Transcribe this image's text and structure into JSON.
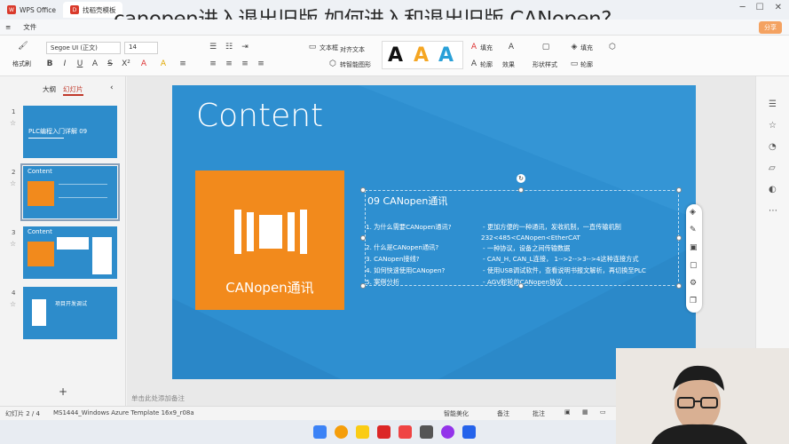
{
  "titlebar": {
    "tabs": [
      {
        "label": "WPS Office",
        "active": false
      },
      {
        "label": "找稻壳模板",
        "active": true
      }
    ],
    "overlay_title": "canopen进入退出旧版,如何进入和退出旧版 CANopen?"
  },
  "menubar": {
    "file": "文件",
    "share": "分享"
  },
  "ribbon": {
    "paste_label": "格式刷",
    "font_name": "Segoe UI (正文)",
    "font_size": "14",
    "text_box": "文本框",
    "convert_smartart": "转智能图形",
    "text_direction": "对齐文本",
    "fill": "填充",
    "outline": "轮廓",
    "effect": "效果",
    "shape_format": "形状样式",
    "fill2": "填充",
    "outline2": "轮廓"
  },
  "left_panel": {
    "tabs": [
      "大纲",
      "幻灯片"
    ],
    "active_tab": "幻灯片",
    "slides": [
      {
        "num": "1",
        "title": "PLC编程入门详解 09"
      },
      {
        "num": "2",
        "title": "Content"
      },
      {
        "num": "3",
        "title": "Content"
      },
      {
        "num": "4",
        "title": "项目开发调试"
      }
    ],
    "add": "+"
  },
  "slide": {
    "title": "Content",
    "box_text": "CANopen通讯",
    "section_title": "09 CANopen通讯",
    "left_lines": [
      "1. 为什么需要CANopen通讯?",
      "2. 什么是CANopen通讯?",
      "3. CANopen接线?",
      "4. 如何快速使用CANopen?",
      "5. 案例分析"
    ],
    "right_lines": [
      "- 更加方便的一种通讯，发收机制，一直传输机制",
      "232<485<CANopen<EtherCAT",
      "- 一种协议，设备之间传输数据",
      "- CAN_H, CAN_L连接，  1-->2-->3-->4这种连接方式",
      "- 使用USB调试软件，查看说明书报文解析，再切换至PLC",
      "- AGV舵轮的CANopen协议"
    ]
  },
  "notes": "单击此处添加备注",
  "status": {
    "slide": "幻灯片 2 / 4",
    "template": "MS1444_Windows Azure Template 16x9_r08a",
    "beautify": "智能美化",
    "notes": "备注",
    "comments": "批注"
  }
}
